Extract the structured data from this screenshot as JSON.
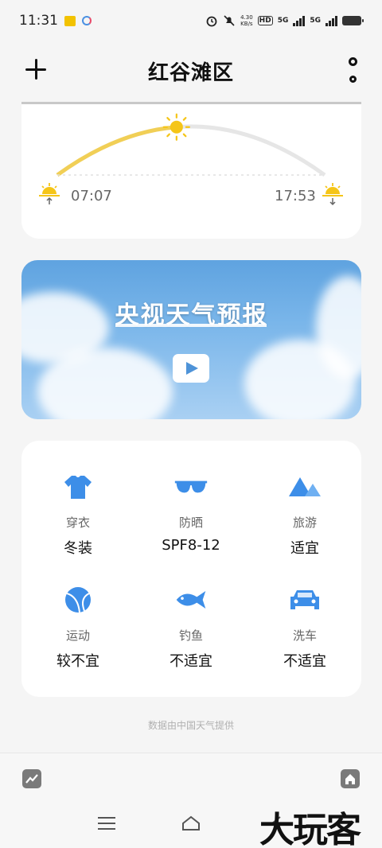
{
  "status_bar": {
    "time": "11:31",
    "net_speed_value": "4.30",
    "net_speed_unit": "KB/s",
    "hd_label": "HD",
    "sig1_label": "5G",
    "sig2_label": "5G"
  },
  "header": {
    "title": "红谷滩区"
  },
  "sun": {
    "sunrise": "07:07",
    "sunset": "17:53",
    "progress": 0.45
  },
  "video": {
    "title": "央视天气预报"
  },
  "life_index": [
    {
      "icon": "shirt-icon",
      "label": "穿衣",
      "value": "冬装"
    },
    {
      "icon": "sunglasses-icon",
      "label": "防晒",
      "value": "SPF8-12"
    },
    {
      "icon": "mountain-icon",
      "label": "旅游",
      "value": "适宜"
    },
    {
      "icon": "ball-icon",
      "label": "运动",
      "value": "较不宜"
    },
    {
      "icon": "fish-icon",
      "label": "钓鱼",
      "value": "不适宜"
    },
    {
      "icon": "car-icon",
      "label": "洗车",
      "value": "不适宜"
    }
  ],
  "footer": {
    "note": "数据由中国天气提供"
  },
  "watermark": "大玩客",
  "colors": {
    "accent_blue": "#3d8ee8",
    "sun_yellow": "#f5c518",
    "arc_gray": "#e6e6e6"
  }
}
